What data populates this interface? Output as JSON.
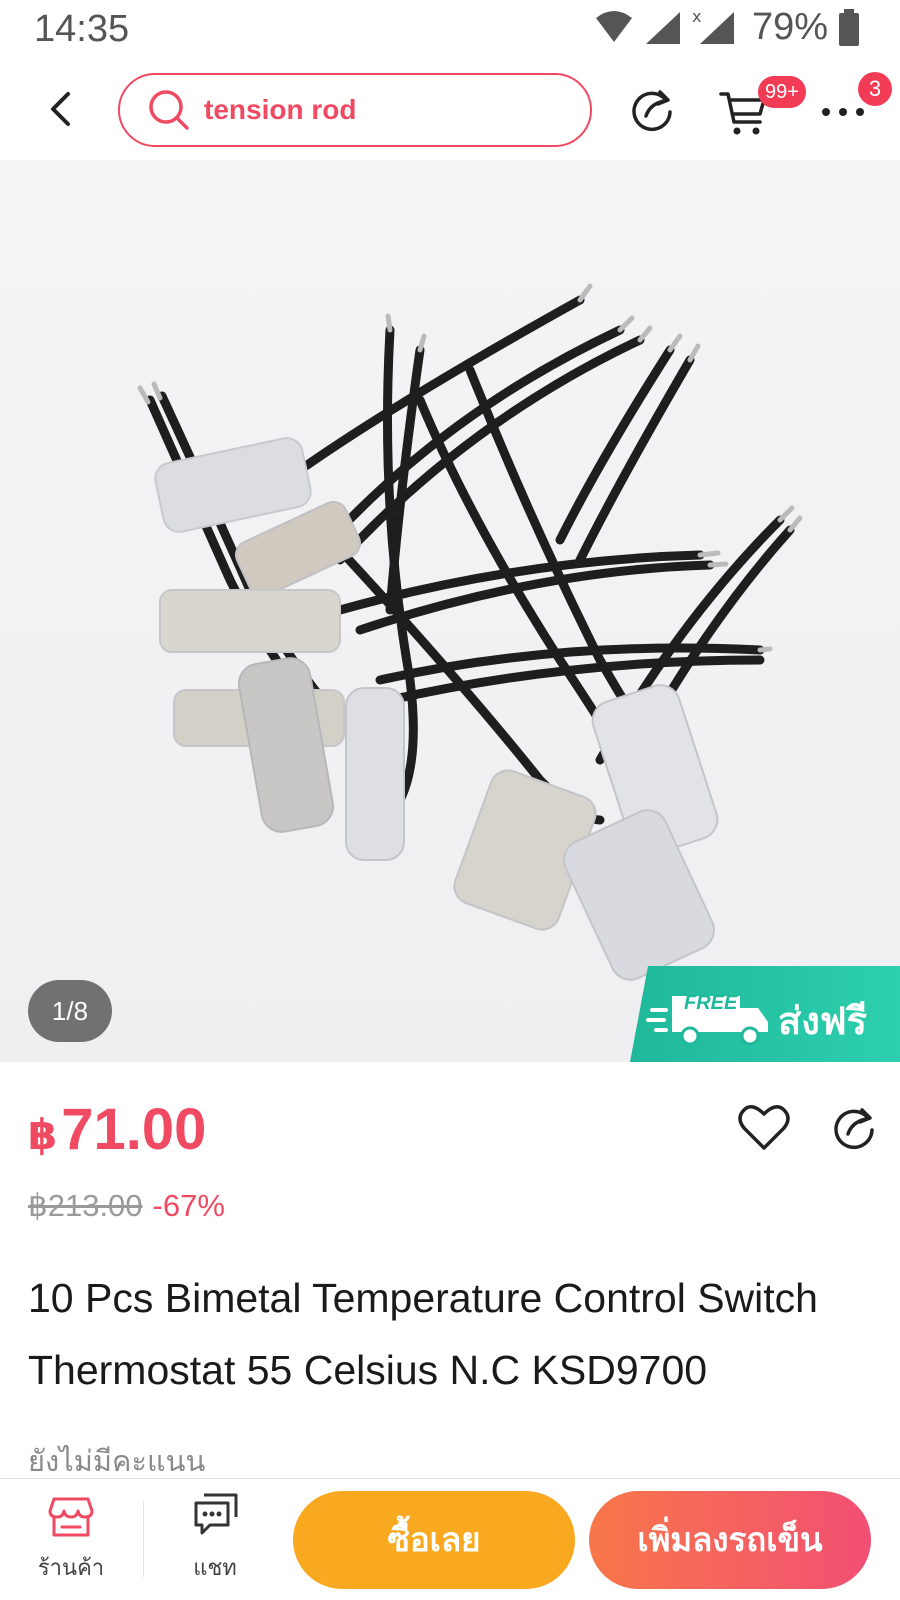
{
  "status_bar": {
    "time": "14:35",
    "battery": "79%",
    "icons": [
      "wifi-icon",
      "signal-icon",
      "signal-x-icon",
      "battery-icon"
    ]
  },
  "header": {
    "search_text": "tension rod",
    "cart_badge": "99+",
    "more_badge": "3",
    "accent_color": "#f04a63"
  },
  "gallery": {
    "page_indicator": "1/8",
    "free_shipping_en": "FREE",
    "free_shipping_th": "ส่งฟรี"
  },
  "product": {
    "currency": "฿",
    "price": "71.00",
    "original_price": "฿213.00",
    "discount": "-67%",
    "title": "10 Pcs Bimetal Temperature Control Switch Thermostat 55 Celsius N.C KSD9700",
    "rating_text": "ยังไม่มีคะแนน"
  },
  "bottom_bar": {
    "shop_label": "ร้านค้า",
    "chat_label": "แชท",
    "buy_now": "ซื้อเลย",
    "add_to_cart": "เพิ่มลงรถเข็น",
    "buy_color": "#f8a91f",
    "cart_color": "#f24f73"
  }
}
